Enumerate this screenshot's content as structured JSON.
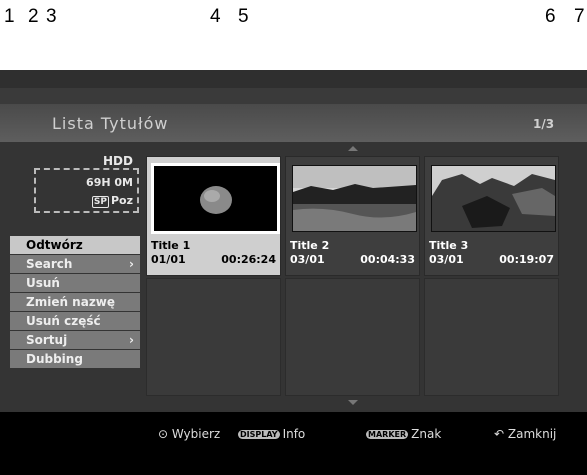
{
  "callouts": [
    "1",
    "2",
    "3",
    "4",
    "5",
    "6",
    "7"
  ],
  "header": {
    "title": "Lista Tytułów",
    "page": "1/3"
  },
  "storage": {
    "device": "HDD",
    "free": "69H 0M",
    "mode_badge": "SP",
    "mode": "Poz"
  },
  "menu": [
    {
      "label": "Odtwórz",
      "arrow": ""
    },
    {
      "label": "Search",
      "arrow": "›"
    },
    {
      "label": "Usuń",
      "arrow": ""
    },
    {
      "label": "Zmień nazwę",
      "arrow": ""
    },
    {
      "label": "Usuń część",
      "arrow": ""
    },
    {
      "label": "Sortuj",
      "arrow": "›"
    },
    {
      "label": "Dubbing",
      "arrow": ""
    }
  ],
  "titles": [
    {
      "name": "Title 1",
      "date": "01/01",
      "length": "00:26:24"
    },
    {
      "name": "Title 2",
      "date": "03/01",
      "length": "00:04:33"
    },
    {
      "name": "Title 3",
      "date": "03/01",
      "length": "00:19:07"
    }
  ],
  "footer": {
    "select_label": "Wybierz",
    "display_key": "DISPLAY",
    "info_label": "Info",
    "marker_key": "MARKER",
    "mark_label": "Znak",
    "close_label": "Zamknij"
  },
  "colors": {
    "background": "#000000",
    "highlight": "#cfcfcf",
    "menu_item": "#7a7a7a"
  }
}
